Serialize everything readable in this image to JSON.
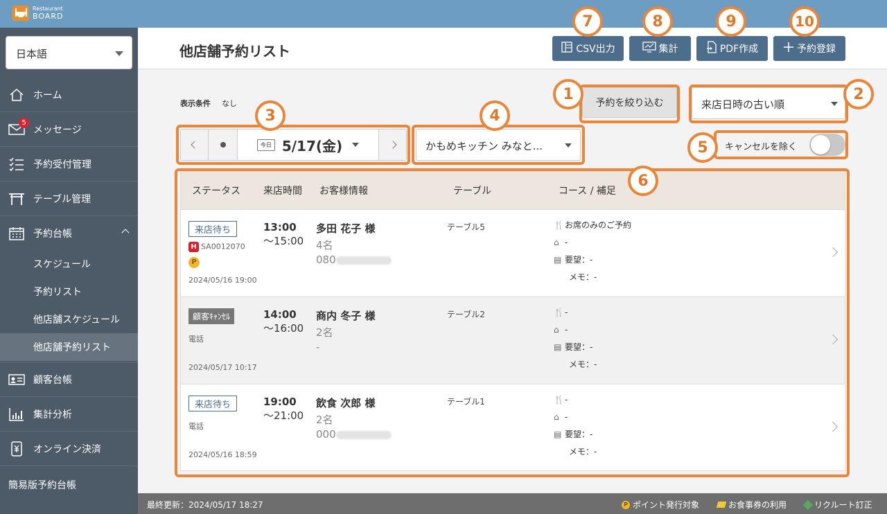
{
  "app": {
    "logo_line1": "Restaurant",
    "logo_line2": "BOARD"
  },
  "sidebar": {
    "language": "日本語",
    "items": [
      {
        "label": "ホーム",
        "icon": "home-icon"
      },
      {
        "label": "メッセージ",
        "icon": "mail-icon",
        "badge": "5"
      },
      {
        "label": "予約受付管理",
        "icon": "checklist-icon"
      },
      {
        "label": "テーブル管理",
        "icon": "table-icon"
      },
      {
        "label": "予約台帳",
        "icon": "calendar-icon"
      }
    ],
    "sub_items": [
      {
        "label": "スケジュール"
      },
      {
        "label": "予約リスト"
      },
      {
        "label": "他店舗スケジュール"
      },
      {
        "label": "他店舗予約リスト",
        "active": true
      }
    ],
    "items2": [
      {
        "label": "顧客台帳",
        "icon": "id-card-icon"
      },
      {
        "label": "集計分析",
        "icon": "bar-chart-icon"
      },
      {
        "label": "オンライン決済",
        "icon": "yen-phone-icon"
      }
    ],
    "simple_label": "簡易版予約台帳"
  },
  "header": {
    "title": "他店舗予約リスト",
    "buttons": {
      "csv": "CSV出力",
      "summary": "集計",
      "pdf": "PDF作成",
      "add": "予約登録"
    }
  },
  "filters": {
    "condition_label": "表示条件",
    "condition_value": "なし",
    "filter_button": "予約を絞り込む",
    "sort": "来店日時の古い順",
    "today_chip": "今日",
    "date": "5/17(金)",
    "store": "かもめキッチン みなと...",
    "exclude_cancel": "キャンセルを除く"
  },
  "table": {
    "columns": [
      "ステータス",
      "来店時間",
      "お客様情報",
      "テーブル",
      "コース / 補足"
    ],
    "rows": [
      {
        "status": "来店待ち",
        "source_id": "SA0012070",
        "source_icon": "H",
        "point_icon": "P",
        "channel": "",
        "created": "2024/05/16 19:00",
        "start": "13:00",
        "end": "〜15:00",
        "name": "多田 花子 様",
        "people": "4名",
        "tel": "080",
        "table": "テーブル5",
        "course": "お席のみのご予約",
        "tag": "-",
        "request": "要望：-",
        "memo": "メモ：-"
      },
      {
        "status": "顧客ｷｬﾝｾﾙ",
        "channel": "電話",
        "created": "2024/05/17 10:17",
        "start": "14:00",
        "end": "〜16:00",
        "name": "商内 冬子 様",
        "people": "2名",
        "tel": "-",
        "table": "テーブル2",
        "course": "-",
        "tag": "-",
        "request": "要望：-",
        "memo": "メモ：-"
      },
      {
        "status": "来店待ち",
        "channel": "電話",
        "created": "2024/05/16 18:59",
        "start": "19:00",
        "end": "〜21:00",
        "name": "飲食 次郎 様",
        "people": "2名",
        "tel": "000",
        "table": "テーブル1",
        "course": "-",
        "tag": "-",
        "request": "要望：-",
        "memo": "メモ：-"
      }
    ]
  },
  "annotations": [
    "1",
    "2",
    "3",
    "4",
    "5",
    "6",
    "7",
    "8",
    "9",
    "10"
  ],
  "footer": {
    "last_updated": "最終更新：2024/05/17 18:27",
    "legend_point": "ポイント発行対象",
    "legend_ticket": "お食事券の利用",
    "legend_recruit": "リクルート訂正"
  },
  "colors": {
    "accent": "#e8863a",
    "topbar": "#6e9dc3",
    "sidebar": "#4d5a67",
    "button": "#4d6d8c"
  }
}
